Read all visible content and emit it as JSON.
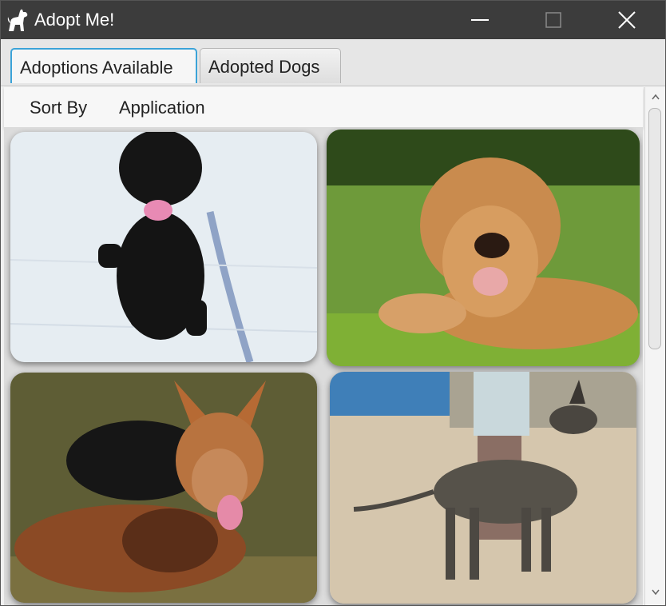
{
  "window": {
    "title": "Adopt Me!"
  },
  "tabs": [
    {
      "label": "Adoptions Available",
      "active": true
    },
    {
      "label": "Adopted Dogs",
      "active": false
    }
  ],
  "menu": [
    {
      "label": "Sort By"
    },
    {
      "label": "Application"
    }
  ],
  "dogs": [
    {
      "icon": "black-pug-photo"
    },
    {
      "icon": "golden-retriever-photo"
    },
    {
      "icon": "german-shepherd-photo"
    },
    {
      "icon": "great-dane-photo"
    }
  ],
  "colors": {
    "accent": "#3ba3d8",
    "titlebar": "#3c3c3c"
  }
}
